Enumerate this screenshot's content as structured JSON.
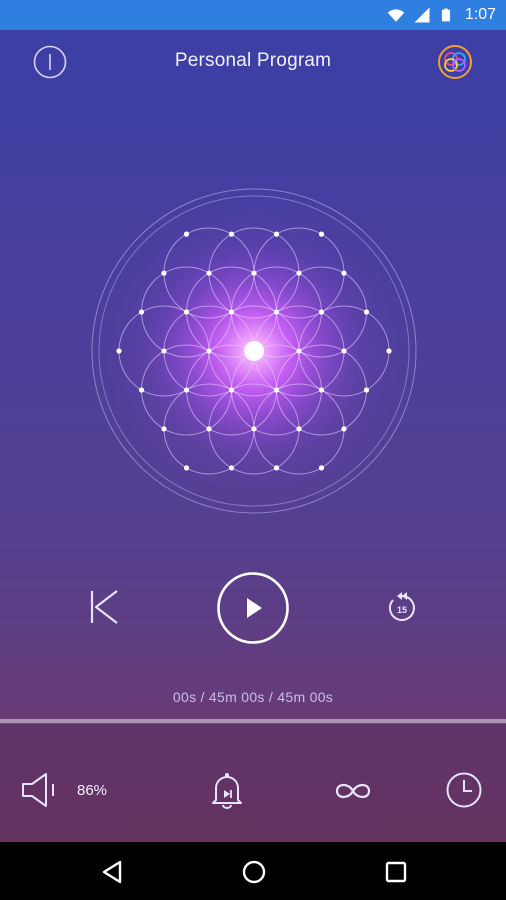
{
  "status_bar": {
    "time": "1:07",
    "icons": [
      "wifi-icon",
      "signal-icon",
      "battery-icon"
    ],
    "color": "#2e7fe0"
  },
  "header": {
    "title": "Personal Program",
    "left_icon": "info-icon",
    "right_icon": "app-logo-icon"
  },
  "visual": {
    "name": "flower-of-life",
    "glow_color": "#d15cff"
  },
  "player": {
    "prev_icon": "skip-previous-icon",
    "play_icon": "play-icon",
    "replay_icon": "replay-15-icon",
    "replay_label": "15",
    "time_text": "00s / 45m 00s / 45m 00s",
    "progress": 0
  },
  "bottom_bar": {
    "volume_icon": "volume-icon",
    "volume_text": "86%",
    "bell_icon": "bell-icon",
    "loop_icon": "infinity-icon",
    "timer_icon": "clock-icon"
  },
  "nav_bar": {
    "icons": [
      "back-icon",
      "home-icon",
      "recents-icon"
    ]
  },
  "colors": {
    "bg_top": "#3a3fa6",
    "bg_bottom": "#6c3a63",
    "accent": "#ffffff"
  }
}
